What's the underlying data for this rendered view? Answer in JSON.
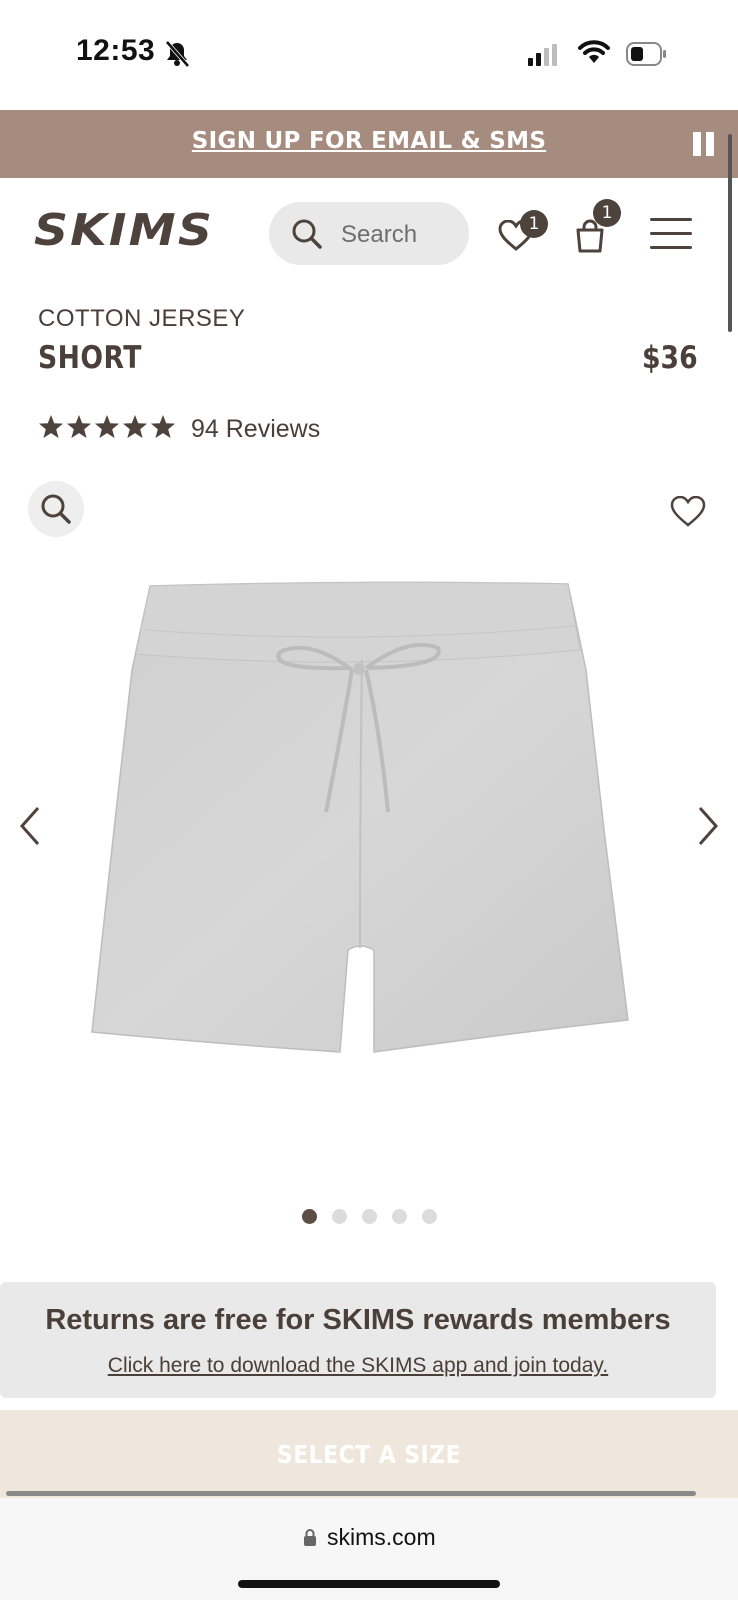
{
  "status_bar": {
    "time": "12:53"
  },
  "promo": {
    "text": "SIGN UP FOR EMAIL & SMS"
  },
  "header": {
    "logo": "SKIMS",
    "search_placeholder": "Search",
    "wishlist_count": "1",
    "bag_count": "1"
  },
  "product": {
    "subtitle": "COTTON JERSEY",
    "title": "SHORT",
    "price": "$36",
    "rating": 5,
    "reviews": "94 Reviews",
    "color": "light heather gray"
  },
  "gallery": {
    "slide_count": 5,
    "active_index": 0
  },
  "returns": {
    "title": "Returns are free for SKIMS rewards members",
    "link": "Click here to download the SKIMS app and join today."
  },
  "cta": {
    "label": "SELECT A SIZE"
  },
  "browser": {
    "url": "skims.com"
  },
  "colors": {
    "brand": "#4d423c",
    "promo_bg": "#a68c7f",
    "cta_bg": "#efe6dc"
  }
}
